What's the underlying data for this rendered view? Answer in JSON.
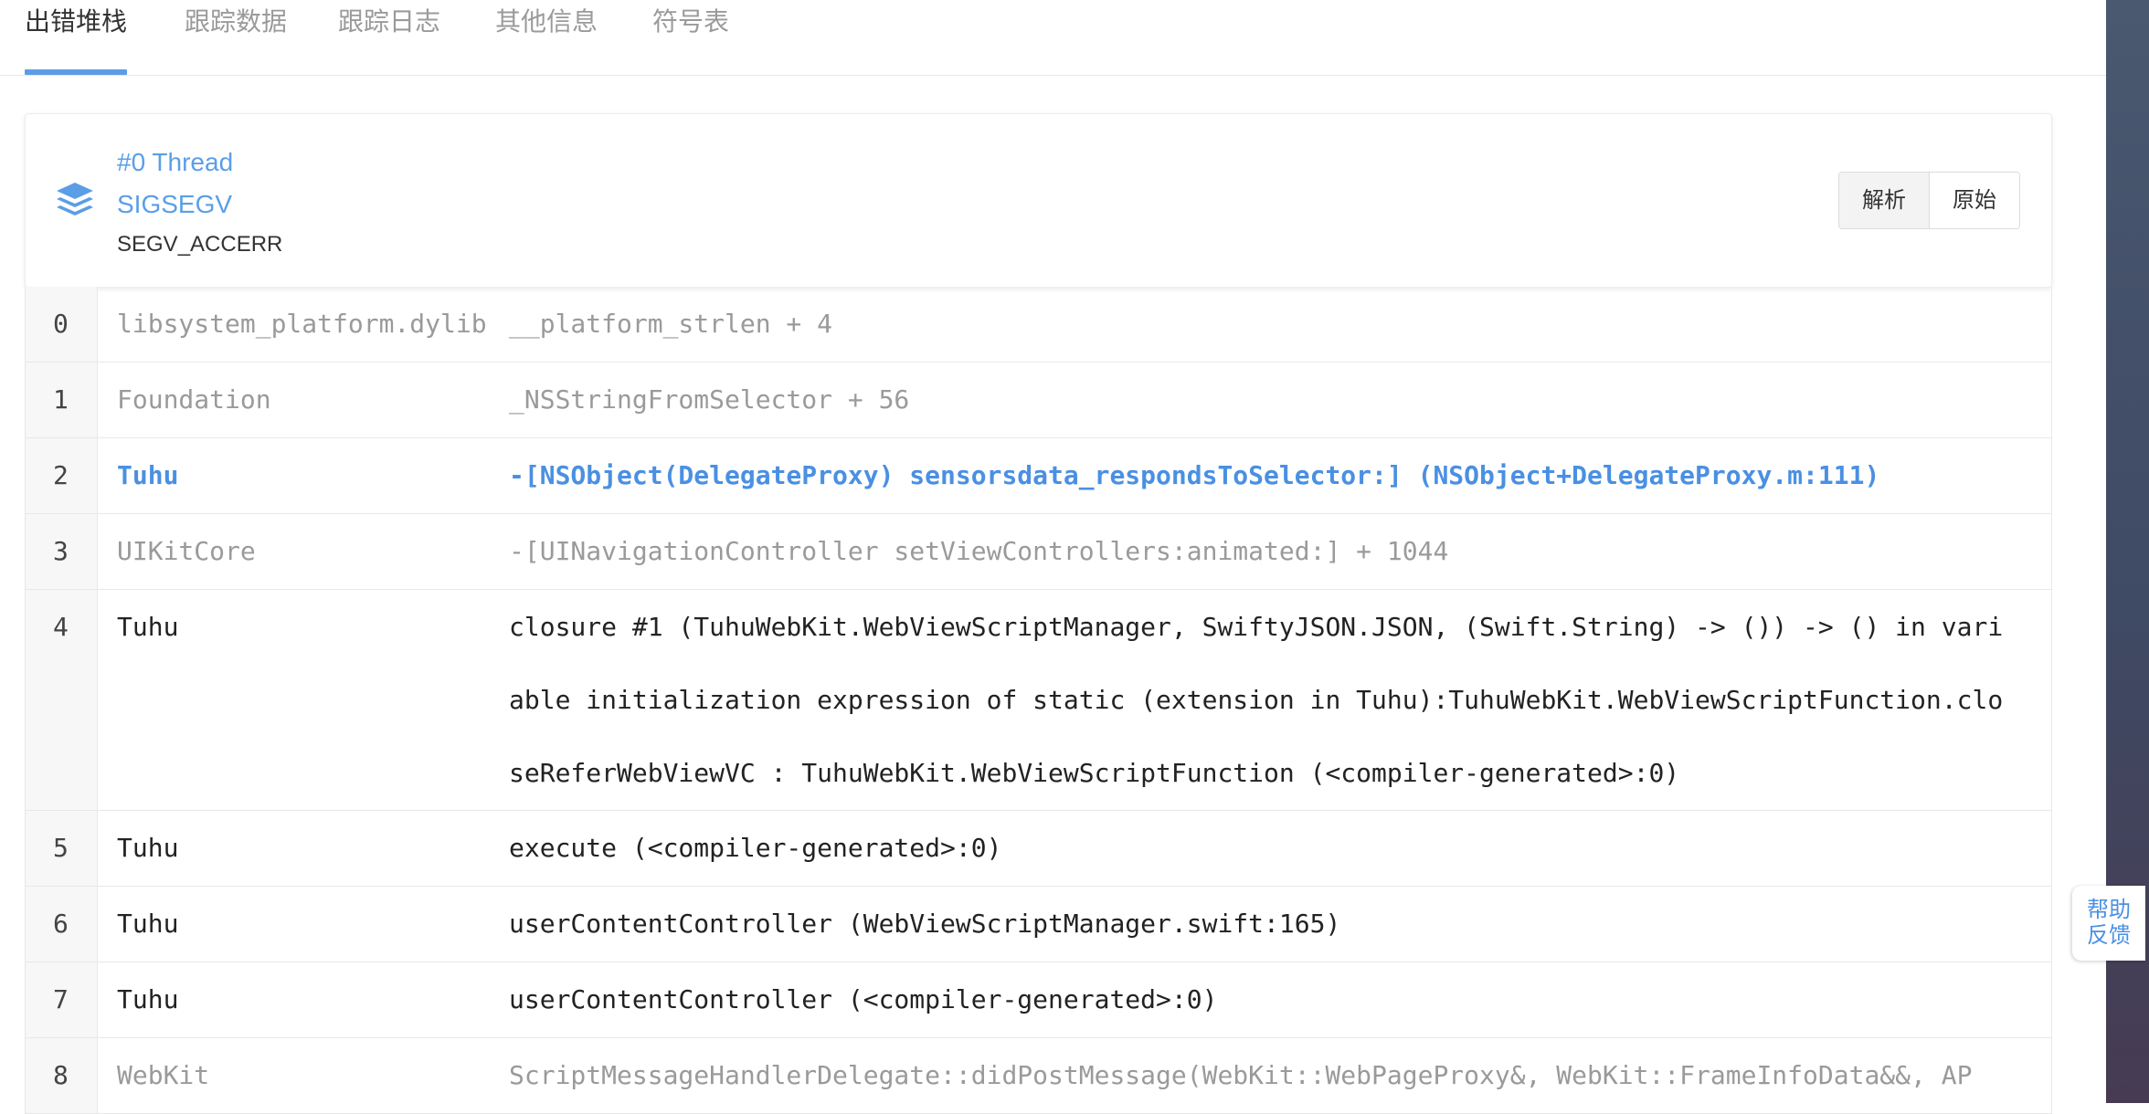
{
  "tabs": [
    {
      "label": "出错堆栈",
      "active": true
    },
    {
      "label": "跟踪数据",
      "active": false
    },
    {
      "label": "跟踪日志",
      "active": false
    },
    {
      "label": "其他信息",
      "active": false
    },
    {
      "label": "符号表",
      "active": false
    }
  ],
  "thread": {
    "icon": "layers-icon",
    "title": "#0 Thread",
    "signal": "SIGSEGV",
    "code": "SEGV_ACCERR",
    "buttons": {
      "parse": "解析",
      "raw": "原始"
    }
  },
  "stack": [
    {
      "index": "0",
      "library": "libsystem_platform.dylib",
      "symbol": "__platform_strlen + 4",
      "style": "gray"
    },
    {
      "index": "1",
      "library": "Foundation",
      "symbol": "_NSStringFromSelector + 56",
      "style": "gray"
    },
    {
      "index": "2",
      "library": "Tuhu",
      "symbol": "-[NSObject(DelegateProxy) sensorsdata_respondsToSelector:] (NSObject+DelegateProxy.m:111)",
      "style": "highlight"
    },
    {
      "index": "3",
      "library": "UIKitCore",
      "symbol": "-[UINavigationController setViewControllers:animated:] + 1044",
      "style": "gray"
    },
    {
      "index": "4",
      "library": "Tuhu",
      "symbol": "closure #1 (TuhuWebKit.WebViewScriptManager, SwiftyJSON.JSON, (Swift.String) -> ()) -> () in variable initialization expression of static (extension in Tuhu):TuhuWebKit.WebViewScriptFunction.closeReferWebViewVC : TuhuWebKit.WebViewScriptFunction (<compiler-generated>:0)",
      "style": "normal"
    },
    {
      "index": "5",
      "library": "Tuhu",
      "symbol": "execute (<compiler-generated>:0)",
      "style": "normal"
    },
    {
      "index": "6",
      "library": "Tuhu",
      "symbol": "userContentController (WebViewScriptManager.swift:165)",
      "style": "normal"
    },
    {
      "index": "7",
      "library": "Tuhu",
      "symbol": "userContentController (<compiler-generated>:0)",
      "style": "normal"
    },
    {
      "index": "8",
      "library": "WebKit",
      "symbol": "ScriptMessageHandlerDelegate::didPostMessage(WebKit::WebPageProxy&, WebKit::FrameInfoData&&, AP",
      "style": "gray"
    }
  ],
  "help": {
    "line1": "帮助",
    "line2": "反馈"
  },
  "colors": {
    "accent": "#5b9ee6",
    "highlight": "#4a90e2",
    "muted": "#9a9a9a"
  }
}
